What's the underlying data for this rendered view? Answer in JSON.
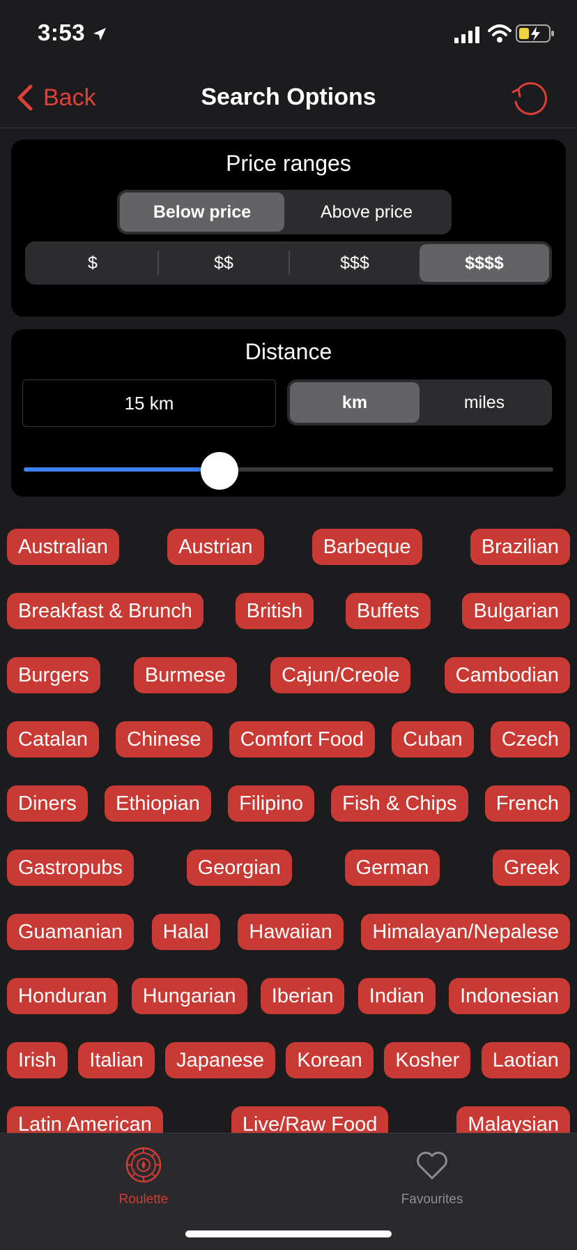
{
  "status_bar": {
    "time": "3:53"
  },
  "nav": {
    "back_label": "Back",
    "title": "Search Options"
  },
  "price": {
    "title": "Price ranges",
    "modes": [
      "Below price",
      "Above price"
    ],
    "selected_mode": 0,
    "levels": [
      "$",
      "$$",
      "$$$",
      "$$$$"
    ],
    "selected_level": 3
  },
  "distance": {
    "title": "Distance",
    "value": "15 km",
    "units": [
      "km",
      "miles"
    ],
    "selected_unit": 0,
    "slider_fraction": 0.37
  },
  "cuisines": [
    [
      "Australian",
      "Austrian",
      "Barbeque",
      "Brazilian"
    ],
    [
      "Breakfast & Brunch",
      "British",
      "Buffets",
      "Bulgarian"
    ],
    [
      "Burgers",
      "Burmese",
      "Cajun/Creole",
      "Cambodian"
    ],
    [
      "Catalan",
      "Chinese",
      "Comfort Food",
      "Cuban",
      "Czech"
    ],
    [
      "Diners",
      "Ethiopian",
      "Filipino",
      "Fish & Chips",
      "French"
    ],
    [
      "Gastropubs",
      "Georgian",
      "German",
      "Greek"
    ],
    [
      "Guamanian",
      "Halal",
      "Hawaiian",
      "Himalayan/Nepalese"
    ],
    [
      "Honduran",
      "Hungarian",
      "Iberian",
      "Indian",
      "Indonesian"
    ],
    [
      "Irish",
      "Italian",
      "Japanese",
      "Korean",
      "Kosher",
      "Laotian"
    ],
    [
      "Latin American",
      "Live/Raw Food",
      "Malaysian"
    ]
  ],
  "tabs": [
    {
      "label": "Roulette",
      "icon": "roulette-icon",
      "active": true
    },
    {
      "label": "Favourites",
      "icon": "heart-icon",
      "active": false
    }
  ],
  "colors": {
    "accent": "#c93a34",
    "background": "#1c1c1e",
    "card": "#000000",
    "slider": "#3a82f7"
  }
}
